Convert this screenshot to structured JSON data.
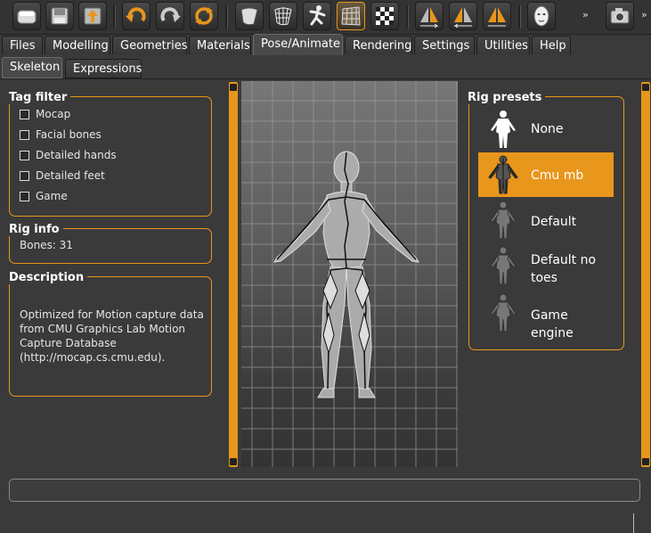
{
  "toolbar": {
    "buttons": [
      {
        "name": "load-icon"
      },
      {
        "name": "save-icon"
      },
      {
        "name": "export-icon"
      },
      {
        "name": "undo-icon"
      },
      {
        "name": "redo-icon"
      },
      {
        "name": "reset-icon"
      },
      {
        "name": "smooth-icon"
      },
      {
        "name": "wireframe-icon"
      },
      {
        "name": "pose-icon"
      },
      {
        "name": "background-grid-icon"
      },
      {
        "name": "checker-icon"
      },
      {
        "name": "symmetry-right-icon"
      },
      {
        "name": "symmetry-left-icon"
      },
      {
        "name": "symmetry-icon"
      },
      {
        "name": "front-view-mask-icon"
      },
      {
        "name": "camera-icon"
      }
    ],
    "more_label": "»",
    "active_button": "background-grid-icon"
  },
  "main_tabs": [
    {
      "label": "Files"
    },
    {
      "label": "Modelling"
    },
    {
      "label": "Geometries"
    },
    {
      "label": "Materials"
    },
    {
      "label": "Pose/Animate",
      "active": true
    },
    {
      "label": "Rendering"
    },
    {
      "label": "Settings"
    },
    {
      "label": "Utilities"
    },
    {
      "label": "Help"
    }
  ],
  "sub_tabs": [
    {
      "label": "Skeleton",
      "active": true
    },
    {
      "label": "Expressions"
    }
  ],
  "tag_filter": {
    "title": "Tag filter",
    "items": [
      {
        "label": "Mocap",
        "checked": false
      },
      {
        "label": "Facial bones",
        "checked": false
      },
      {
        "label": "Detailed hands",
        "checked": false
      },
      {
        "label": "Detailed feet",
        "checked": false
      },
      {
        "label": "Game",
        "checked": false
      }
    ]
  },
  "rig_info": {
    "title": "Rig info",
    "bones_text": "Bones: 31"
  },
  "description": {
    "title": "Description",
    "lines": [
      "Optimized for Motion capture data",
      "from CMU Graphics Lab Motion",
      "Capture Database",
      "(http://mocap.cs.cmu.edu)."
    ]
  },
  "rig_presets": {
    "title": "Rig presets",
    "items": [
      {
        "label_lines": [
          "None"
        ],
        "selected": false
      },
      {
        "label_lines": [
          "Cmu mb"
        ],
        "selected": true
      },
      {
        "label_lines": [
          "Default"
        ],
        "selected": false
      },
      {
        "label_lines": [
          "Default no",
          "toes"
        ],
        "selected": false
      },
      {
        "label_lines": [
          "Game engine"
        ],
        "selected": false
      }
    ]
  },
  "colors": {
    "accent": "#e8961c",
    "background": "#3a3a3a",
    "text": "#e6e6e6"
  }
}
